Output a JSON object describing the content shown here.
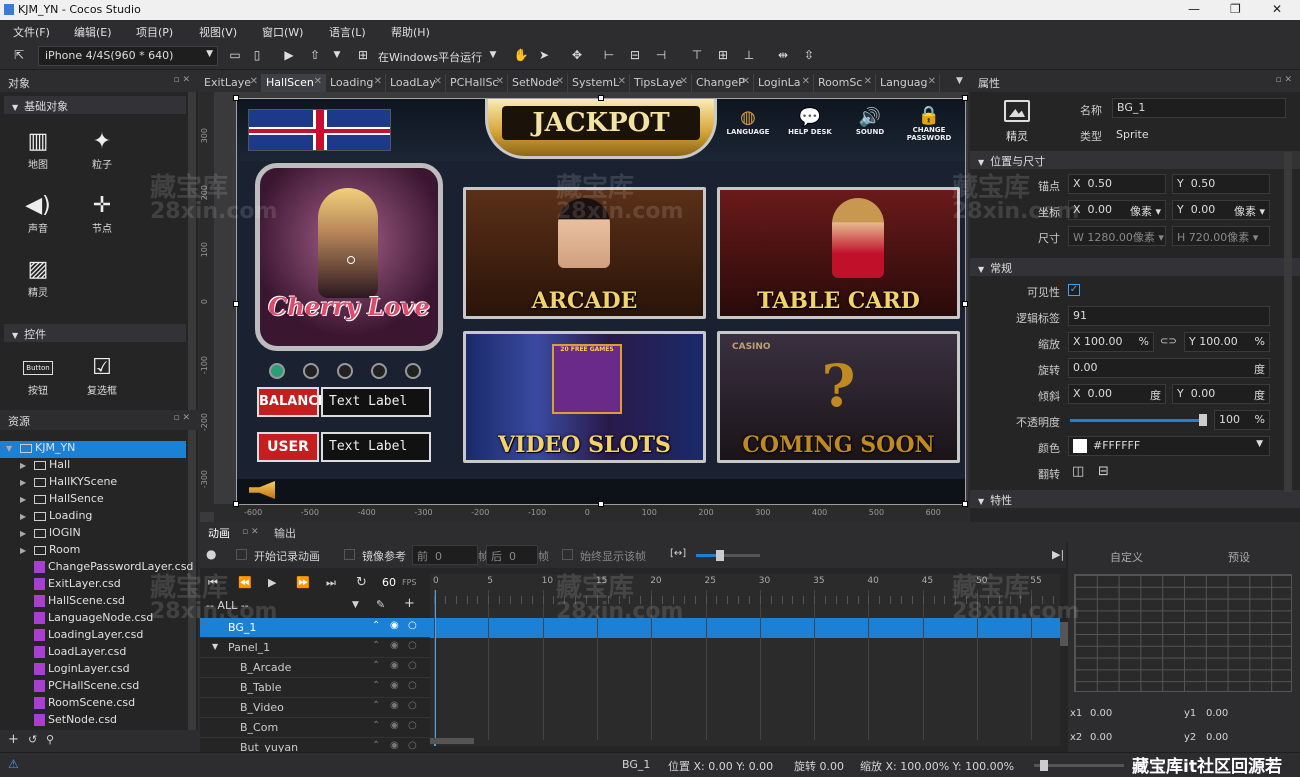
{
  "window": {
    "title": "KJM_YN - Cocos Studio",
    "minimize": "—",
    "restore": "❐",
    "close": "✕"
  },
  "menu": [
    "文件(F)",
    "编辑(E)",
    "项目(P)",
    "视图(V)",
    "窗口(W)",
    "语言(L)",
    "帮助(H)"
  ],
  "toolbar": {
    "device": "iPhone 4/4S(960 * 640)",
    "run_target": "在Windows平台运行"
  },
  "objects_panel": {
    "title": "对象",
    "basic_section": "基础对象",
    "basic_items": [
      {
        "label": "地图",
        "icon": "map-icon"
      },
      {
        "label": "粒子",
        "icon": "particle-icon"
      },
      {
        "label": "声音",
        "icon": "sound-icon"
      },
      {
        "label": "节点",
        "icon": "node-icon"
      },
      {
        "label": "精灵",
        "icon": "sprite-icon"
      }
    ],
    "controls_section": "控件",
    "control_items": [
      {
        "label": "按钮",
        "icon": "button-icon",
        "glyph": "Button"
      },
      {
        "label": "复选框",
        "icon": "checkbox-icon"
      }
    ]
  },
  "resources_panel": {
    "title": "资源",
    "root": "KJM_YN",
    "folders": [
      "Hall",
      "HallKYScene",
      "HallSence",
      "Loading",
      "lOGIN",
      "Room"
    ],
    "files": [
      "ChangePasswordLayer.csd",
      "ExitLayer.csd",
      "HallScene.csd",
      "LanguageNode.csd",
      "LoadingLayer.csd",
      "LoadLayer.csd",
      "LoginLayer.csd",
      "PCHallScene.csd",
      "RoomScene.csd",
      "SetNode.csd"
    ]
  },
  "doc_tabs": [
    "ExitLaye",
    "HallScen",
    "Loading",
    "LoadLay",
    "PCHallSc",
    "SetNode",
    "SystemL",
    "TipsLaye",
    "ChangeP",
    "LoginLa",
    "RoomSc",
    "Languag"
  ],
  "active_tab": 1,
  "rulers": {
    "x": [
      "-600",
      "-500",
      "-400",
      "-300",
      "-200",
      "-100",
      "0",
      "100",
      "200",
      "300",
      "400",
      "500",
      "600"
    ],
    "y": [
      "300",
      "200",
      "100",
      "0",
      "-100",
      "-200",
      "-300"
    ]
  },
  "game": {
    "jackpot": "JACKPOT",
    "top_buttons": [
      "LANGUAGE",
      "HELP DESK",
      "SOUND",
      "CHANGE PASSWORD"
    ],
    "featured": "Cherry Love",
    "tiles": [
      "ARCADE",
      "TABLE CARD",
      "VIDEO SLOTS",
      "COMING SOON"
    ],
    "balance_label": "BALANCE",
    "user_label": "USER",
    "text_label": "Text Label",
    "slot_banner": "20 FREE GAMES",
    "casino_sign": "CASINO"
  },
  "properties": {
    "title": "属性",
    "type_icon_label": "精灵",
    "name_label": "名称",
    "name_value": "BG_1",
    "type_label": "类型",
    "type_value": "Sprite",
    "pos_section": "位置与尺寸",
    "anchor_label": "锚点",
    "anchor_x": "0.50",
    "anchor_y": "0.50",
    "coord_label": "坐标",
    "pos_x": "0.00",
    "pos_y": "0.00",
    "unit_px": "像素",
    "size_label": "尺寸",
    "size_w": "1280.00像素",
    "size_h": "720.00像素",
    "general_section": "常规",
    "visible_label": "可见性",
    "tag_label": "逻辑标签",
    "tag_value": "91",
    "scale_label": "缩放",
    "scale_x": "100.00",
    "scale_y": "100.00",
    "pct": "%",
    "rotate_label": "旋转",
    "rotate_value": "0.00",
    "deg": "度",
    "skew_label": "倾斜",
    "skew_x": "0.00",
    "skew_y": "0.00",
    "opacity_label": "不透明度",
    "opacity_value": "100",
    "opacity_fraction": 0.98,
    "color_label": "颜色",
    "color_value": "#FFFFFF",
    "flip_label": "翻转",
    "feature_section": "特性",
    "x": "X",
    "y": "Y",
    "w": "W",
    "h": "H"
  },
  "animation": {
    "tab_anim": "动画",
    "tab_output": "输出",
    "record_label": "开始记录动画",
    "mirror_label": "镜像参考",
    "front_label": "前",
    "front_value": "0",
    "back_label": "后",
    "back_value": "0",
    "frame_unit": "帧",
    "always_show": "始终显示该帧",
    "fps": "60",
    "fps_unit": "FPS",
    "filter": "-- ALL --",
    "tracks": [
      {
        "name": "BG_1",
        "selected": true
      },
      {
        "name": "Panel_1"
      },
      {
        "name": "B_Arcade"
      },
      {
        "name": "B_Table"
      },
      {
        "name": "B_Video"
      },
      {
        "name": "B_Com"
      },
      {
        "name": "But_yuyan"
      }
    ],
    "ticks": [
      "0",
      "5",
      "10",
      "15",
      "20",
      "25",
      "30",
      "35",
      "40",
      "45",
      "50",
      "55"
    ],
    "curve_tabs": [
      "自定义",
      "预设"
    ],
    "x1": "0.00",
    "y1": "0.00",
    "x2": "0.00",
    "y2": "0.00",
    "x1_label": "x1",
    "y1_label": "y1",
    "x2_label": "x2",
    "y2_label": "y2"
  },
  "status": {
    "node": "BG_1",
    "pos": "位置 X: 0.00   Y: 0.00",
    "rot": "旋转 0.00",
    "scale": "缩放 X: 100.00%   Y: 100.00%"
  },
  "watermark": {
    "cn": "藏宝库",
    "en": "28xin.com",
    "footer": "藏宝库it社区回源若"
  }
}
